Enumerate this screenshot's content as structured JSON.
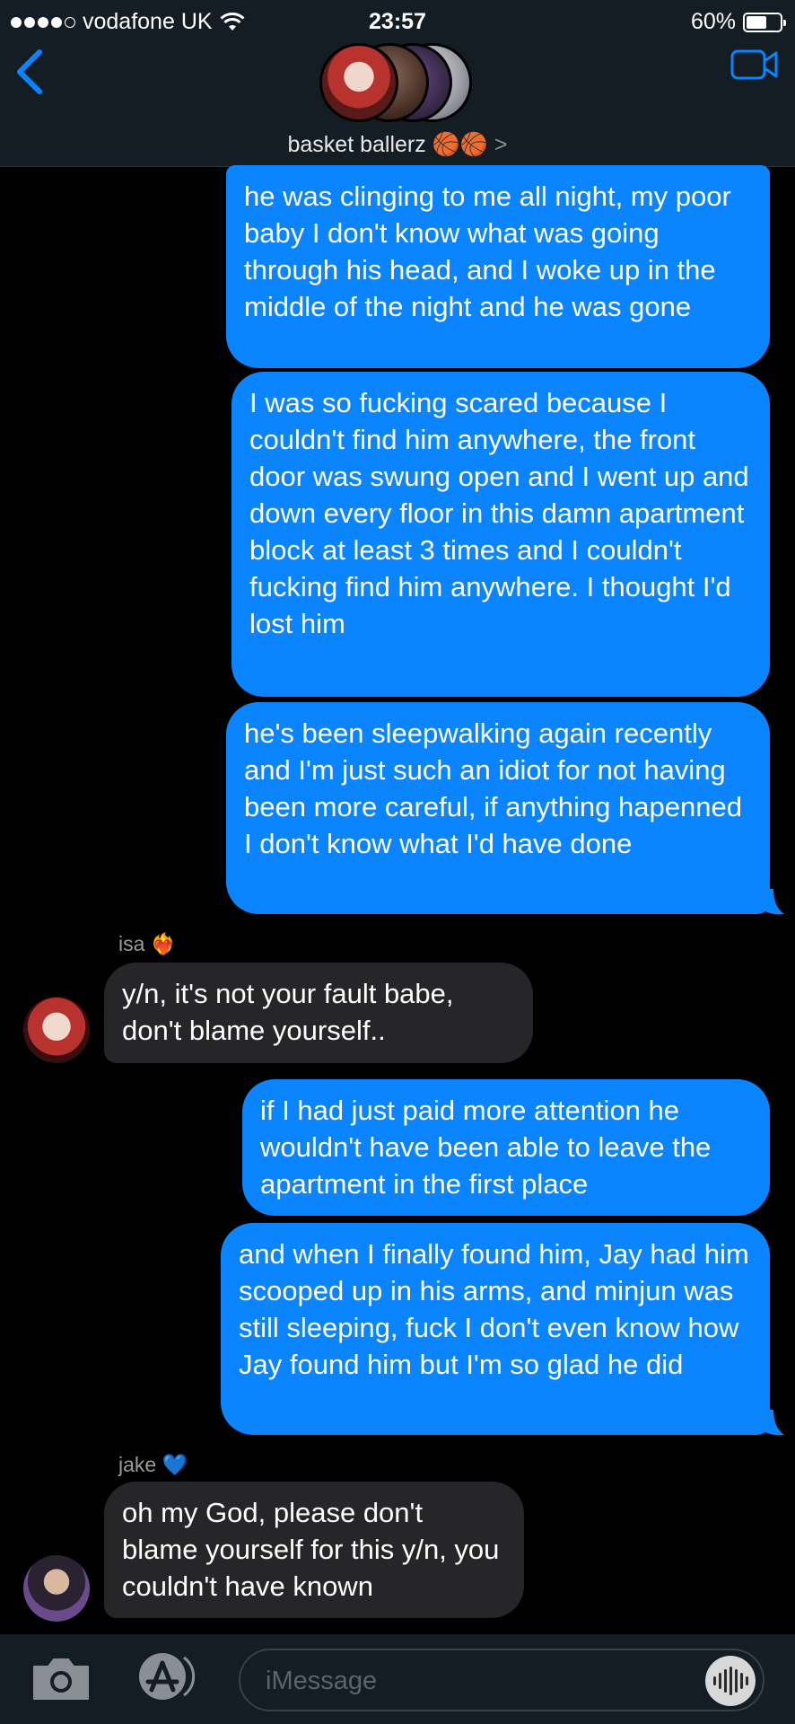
{
  "status": {
    "carrier": "vodafone UK",
    "time": "23:57",
    "battery": "60%",
    "battery_level": 0.6
  },
  "header": {
    "group_name": "basket ballerz 🏀🏀",
    "chevron": ">"
  },
  "colors": {
    "outgoing": "#0a84ff",
    "incoming": "#262628",
    "header_bg": "#141c24",
    "accent": "#0a84ff"
  },
  "messages": [
    {
      "text": "he was clinging to me all night, my poor baby I don't know what was going through his head, and I woke up in the middle of the night and he was gone"
    },
    {
      "text": "I was so fucking scared because I couldn't find him anywhere, the front door was swung open and I went up and down every floor in this damn apartment block at least 3 times and I couldn't fucking find him anywhere. I thought I'd lost him"
    },
    {
      "text": "he's been sleepwalking again recently and I'm just such an idiot for not having been more careful, if anything hapenned I don't know what I'd have done"
    },
    {
      "sender": "isa ❤️‍🔥",
      "text": "y/n, it's not your fault babe, don't blame yourself.."
    },
    {
      "text": "if I had just paid more attention he wouldn't have been able to leave the apartment in the first place"
    },
    {
      "text": "and when I finally found him, Jay had him scooped up in his arms, and minjun was still sleeping, fuck I don't even know how Jay found him but I'm so glad he did"
    },
    {
      "sender": "jake 💙",
      "text": "oh my God, please don't blame yourself for this y/n, you couldn't have known"
    }
  ],
  "input": {
    "placeholder": "iMessage"
  }
}
